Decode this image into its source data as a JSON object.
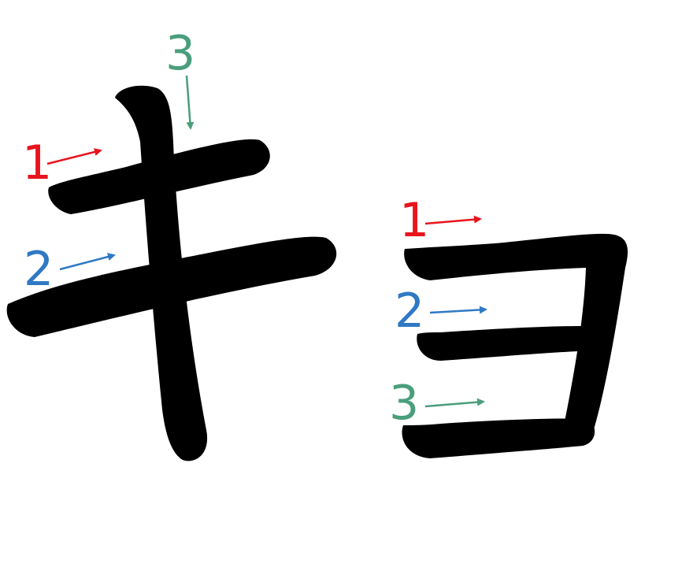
{
  "characters": [
    {
      "glyph": "キ",
      "strokes": [
        {
          "order": "1",
          "color": "#e8141e"
        },
        {
          "order": "2",
          "color": "#2f79c4"
        },
        {
          "order": "3",
          "color": "#4a9e7c"
        }
      ]
    },
    {
      "glyph": "ョ",
      "strokes": [
        {
          "order": "1",
          "color": "#e8141e"
        },
        {
          "order": "2",
          "color": "#2f79c4"
        },
        {
          "order": "3",
          "color": "#4a9e7c"
        }
      ]
    }
  ],
  "ink_color": "#000000"
}
